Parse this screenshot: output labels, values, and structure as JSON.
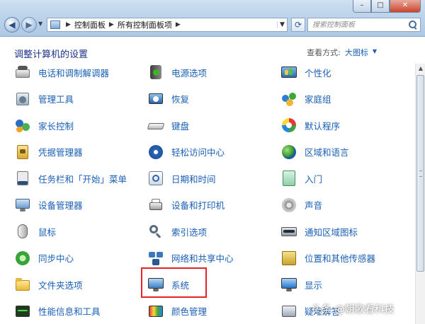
{
  "window": {
    "minimize": "–",
    "maximize": "□",
    "close": "✕"
  },
  "address": {
    "crumbs": [
      "控制面板",
      "所有控制面板项"
    ],
    "search_placeholder": "搜索控制面板"
  },
  "header": {
    "title": "调整计算机的设置",
    "view_label": "查看方式:",
    "view_value": "大图标"
  },
  "items": [
    {
      "label": "电话和调制解调器",
      "icon": "phone-modem-icon"
    },
    {
      "label": "电源选项",
      "icon": "power-options-icon"
    },
    {
      "label": "个性化",
      "icon": "personalization-icon"
    },
    {
      "label": "管理工具",
      "icon": "admin-tools-icon"
    },
    {
      "label": "恢复",
      "icon": "recovery-icon"
    },
    {
      "label": "家庭组",
      "icon": "homegroup-icon"
    },
    {
      "label": "家长控制",
      "icon": "parental-controls-icon"
    },
    {
      "label": "键盘",
      "icon": "keyboard-icon"
    },
    {
      "label": "默认程序",
      "icon": "default-programs-icon"
    },
    {
      "label": "凭据管理器",
      "icon": "credential-manager-icon"
    },
    {
      "label": "轻松访问中心",
      "icon": "ease-of-access-icon"
    },
    {
      "label": "区域和语言",
      "icon": "region-language-icon"
    },
    {
      "label": "任务栏和「开始」菜单",
      "icon": "taskbar-start-menu-icon"
    },
    {
      "label": "日期和时间",
      "icon": "date-time-icon"
    },
    {
      "label": "入门",
      "icon": "getting-started-icon"
    },
    {
      "label": "设备管理器",
      "icon": "device-manager-icon"
    },
    {
      "label": "设备和打印机",
      "icon": "devices-printers-icon"
    },
    {
      "label": "声音",
      "icon": "sound-icon"
    },
    {
      "label": "鼠标",
      "icon": "mouse-icon"
    },
    {
      "label": "索引选项",
      "icon": "indexing-options-icon"
    },
    {
      "label": "通知区域图标",
      "icon": "notification-area-icon"
    },
    {
      "label": "同步中心",
      "icon": "sync-center-icon"
    },
    {
      "label": "网络和共享中心",
      "icon": "network-sharing-icon"
    },
    {
      "label": "位置和其他传感器",
      "icon": "location-sensors-icon"
    },
    {
      "label": "文件夹选项",
      "icon": "folder-options-icon"
    },
    {
      "label": "系统",
      "icon": "system-icon"
    },
    {
      "label": "显示",
      "icon": "display-icon"
    },
    {
      "label": "性能信息和工具",
      "icon": "performance-icon"
    },
    {
      "label": "颜色管理",
      "icon": "color-management-icon"
    },
    {
      "label": "疑难解答",
      "icon": "troubleshooting-icon"
    }
  ],
  "colors": {
    "link": "#1a5fb4",
    "title": "#1e3287",
    "highlight": "#e2242a"
  },
  "watermark": "头条 @朝歌看科技"
}
